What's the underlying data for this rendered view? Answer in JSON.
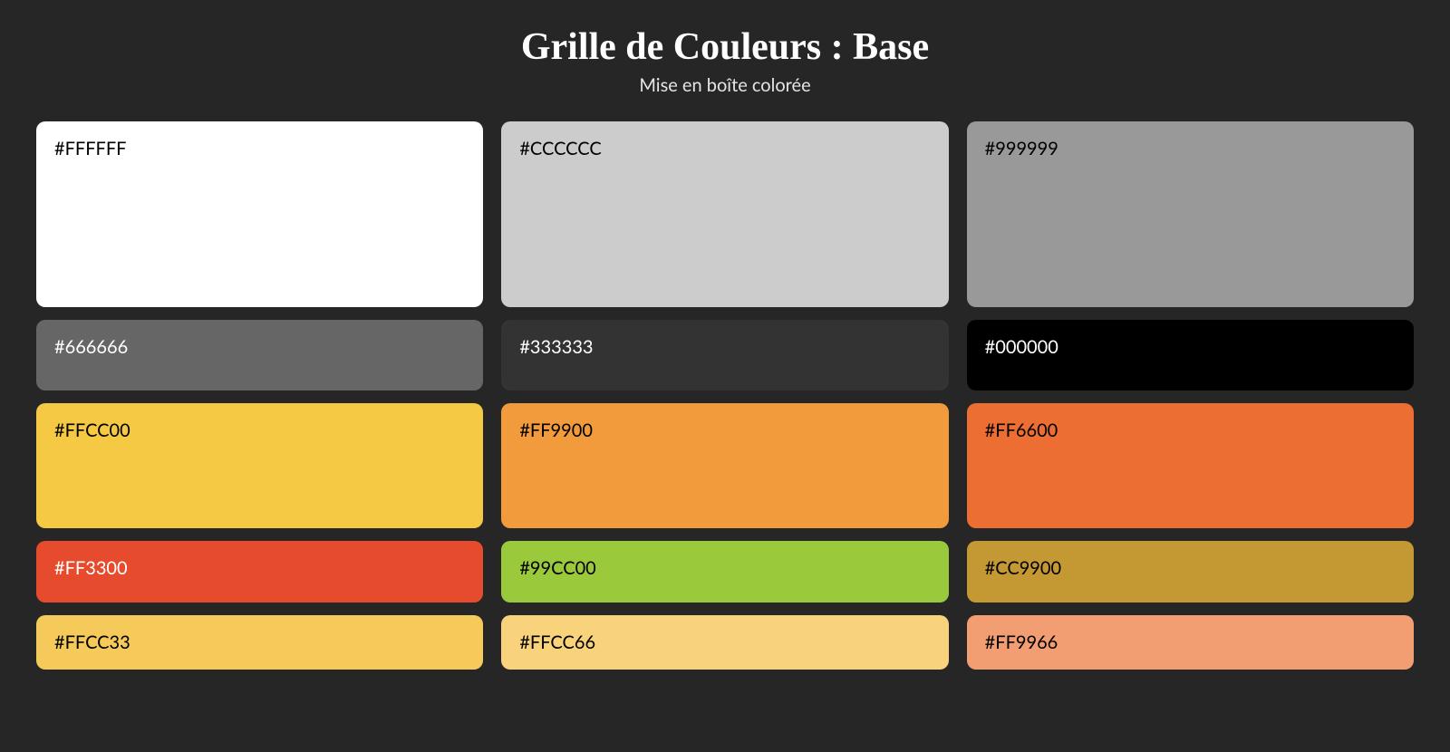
{
  "title": "Grille de Couleurs : Base",
  "subtitle": "Mise en boîte colorée",
  "swatches": {
    "r0c0": {
      "label": "#FFFFFF",
      "hex": "#FFFFFF"
    },
    "r0c1": {
      "label": "#CCCCCC",
      "hex": "#CCCCCC"
    },
    "r0c2": {
      "label": "#999999",
      "hex": "#999999"
    },
    "r1c0": {
      "label": "#666666",
      "hex": "#666666"
    },
    "r1c1": {
      "label": "#333333",
      "hex": "#333333"
    },
    "r1c2": {
      "label": "#000000",
      "hex": "#000000"
    },
    "r2c0": {
      "label": "#FFCC00",
      "hex": "#F6C944"
    },
    "r2c1": {
      "label": "#FF9900",
      "hex": "#F19B3C"
    },
    "r2c2": {
      "label": "#FF6600",
      "hex": "#EC6E33"
    },
    "r3c0": {
      "label": "#FF3300",
      "hex": "#E74B2D"
    },
    "r3c1": {
      "label": "#99CC00",
      "hex": "#9BC93C"
    },
    "r3c2": {
      "label": "#CC9900",
      "hex": "#C49833"
    },
    "r4c0": {
      "label": "#FFCC33",
      "hex": "#F6CA5A"
    },
    "r4c1": {
      "label": "#FFCC66",
      "hex": "#F9D27C"
    },
    "r4c2": {
      "label": "#FF9966",
      "hex": "#F29E72"
    }
  }
}
